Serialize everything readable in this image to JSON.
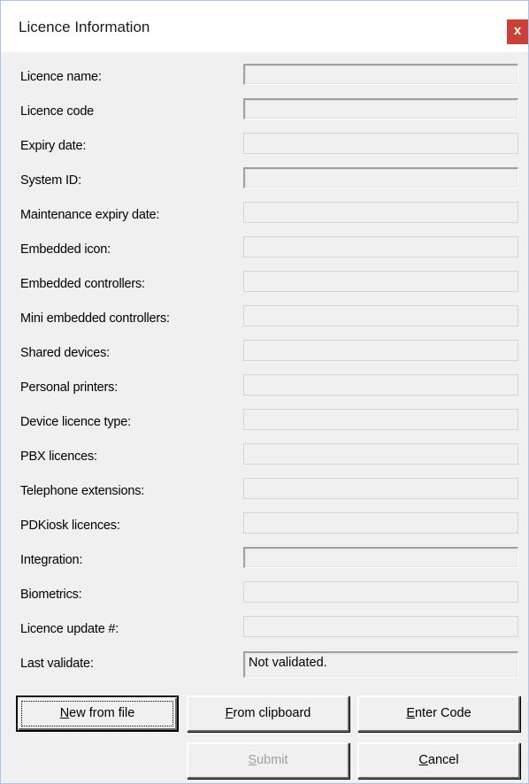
{
  "window": {
    "title": "Licence Information",
    "close_label": "x"
  },
  "labels": {
    "licence_name": "Licence name:",
    "licence_code": "Licence code",
    "expiry_date": "Expiry date:",
    "system_id": "System ID:",
    "maintenance_expiry": "Maintenance expiry date:",
    "embedded_icon": "Embedded icon:",
    "embedded_controllers": "Embedded controllers:",
    "mini_embedded_controllers": "Mini embedded controllers:",
    "shared_devices": "Shared devices:",
    "personal_printers": "Personal printers:",
    "device_licence_type": "Device licence type:",
    "pbx_licences": "PBX licences:",
    "telephone_extensions": "Telephone extensions:",
    "pdkiosk_licences": "PDKiosk licences:",
    "integration": "Integration:",
    "biometrics": "Biometrics:",
    "licence_update": "Licence update #:",
    "last_validate": "Last validate:"
  },
  "values": {
    "licence_name": "",
    "licence_code": "",
    "expiry_date": "",
    "system_id": "",
    "maintenance_expiry": "",
    "embedded_icon": "",
    "embedded_controllers": "",
    "mini_embedded_controllers": "",
    "shared_devices": "",
    "personal_printers": "",
    "device_licence_type": "",
    "pbx_licences": "",
    "telephone_extensions": "",
    "pdkiosk_licences": "",
    "integration": "",
    "biometrics": "",
    "licence_update": "",
    "last_validate": "Not validated."
  },
  "buttons": {
    "new_from_file": {
      "hotkey": "N",
      "rest": "ew from file"
    },
    "from_clipboard": {
      "hotkey": "F",
      "rest": "rom clipboard"
    },
    "enter_code": {
      "hotkey": "E",
      "rest": "nter Code"
    },
    "submit": {
      "hotkey": "S",
      "rest": "ubmit"
    },
    "cancel": {
      "hotkey": "C",
      "rest": "ancel"
    }
  }
}
